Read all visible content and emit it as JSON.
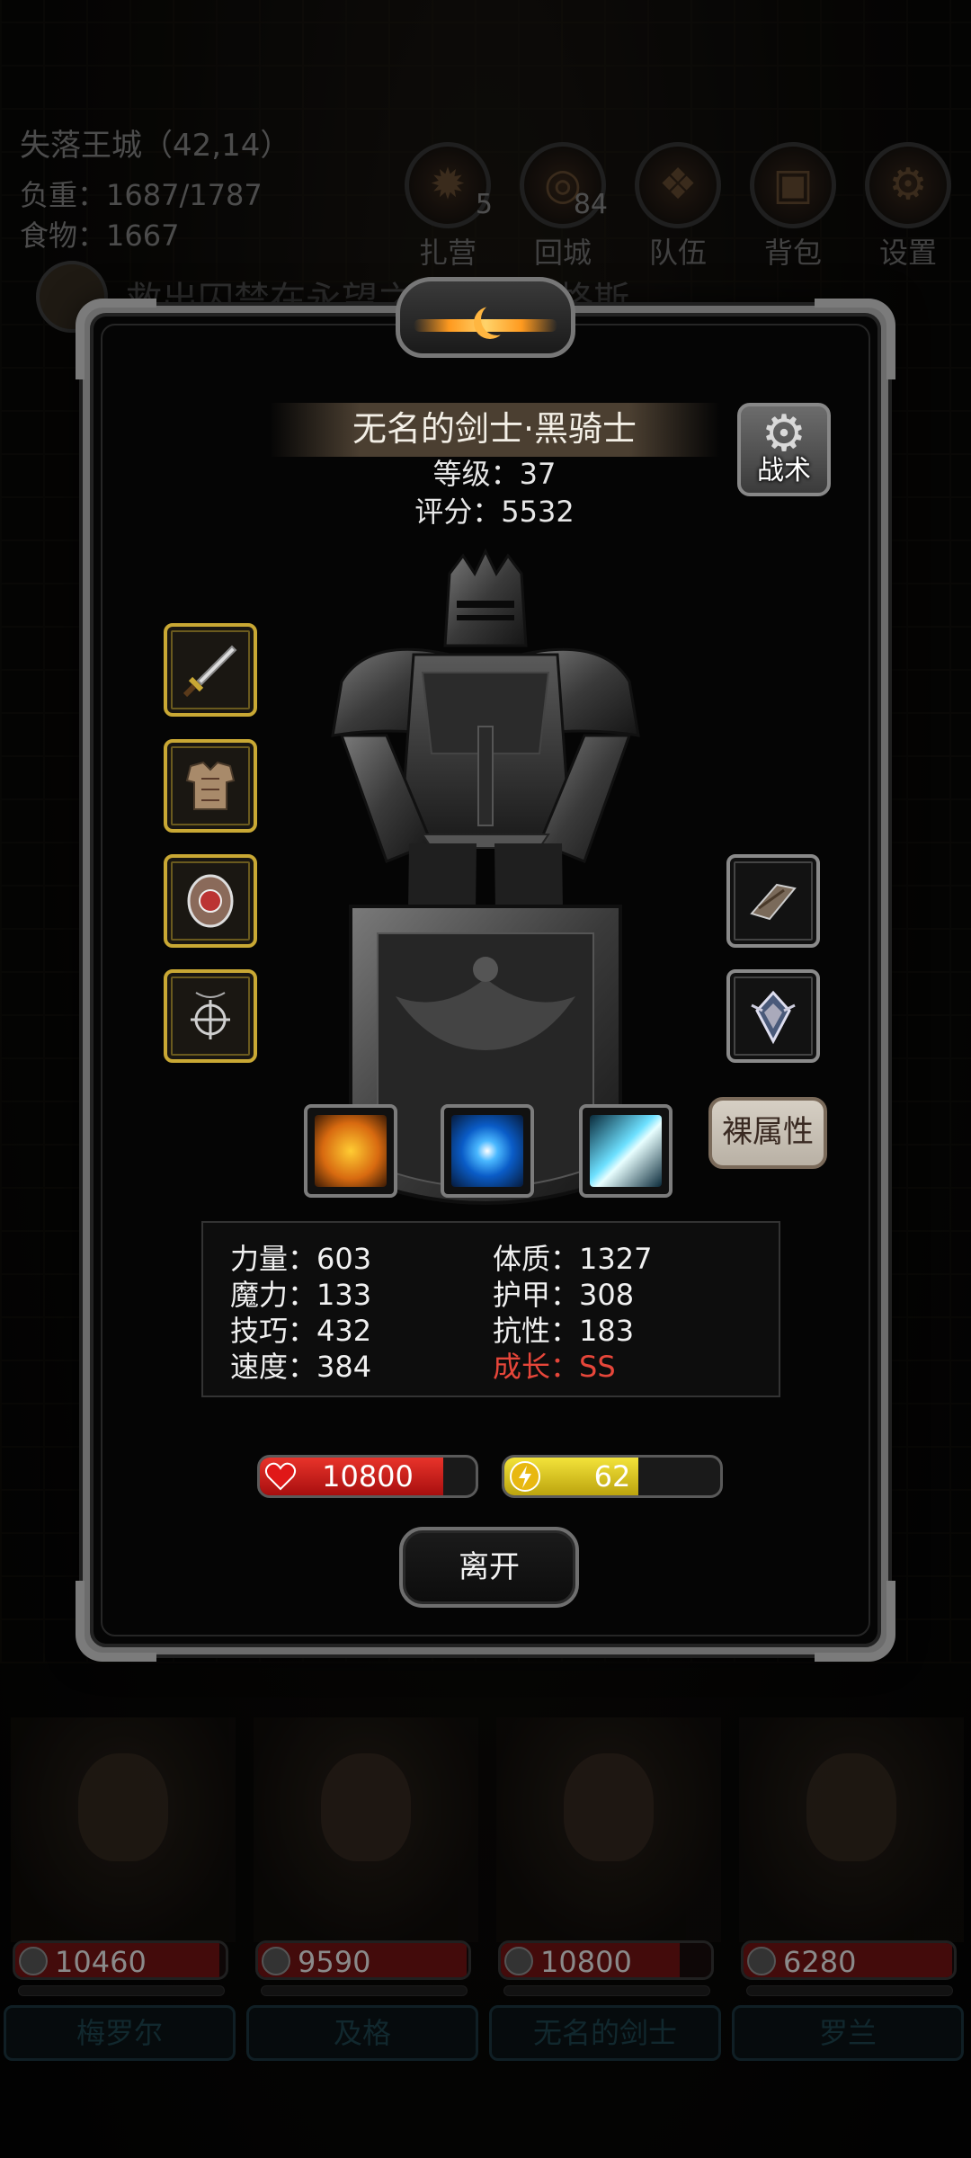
{
  "hud": {
    "location": "失落王城（42,14）",
    "load_label": "负重：",
    "load_value": "1687/1787",
    "food_label": "食物：",
    "food_value": "1667",
    "menu": [
      {
        "label": "扎营",
        "badge": "5",
        "icon": "campfire-icon"
      },
      {
        "label": "回城",
        "badge": "84",
        "icon": "portal-icon"
      },
      {
        "label": "队伍",
        "badge": "",
        "icon": "team-icon"
      },
      {
        "label": "背包",
        "badge": "",
        "icon": "backpack-icon"
      },
      {
        "label": "设置",
        "badge": "",
        "icon": "gear-icon"
      }
    ],
    "quest": "救出囚禁在永望之殿的克拉格斯"
  },
  "character": {
    "title": "无名的剑士·黑骑士",
    "level": "等级：37",
    "score": "评分：5532",
    "tactics_label": "战术",
    "bare_stats_label": "裸属性",
    "equipment_left": [
      "sword-icon",
      "armor-icon",
      "shield-ring-icon",
      "amulet-icon"
    ],
    "equipment_right": [
      "bracer-icon",
      "emblem-icon"
    ],
    "skills": [
      "dark-shield-skill-icon",
      "eye-skill-icon",
      "slash-skill-icon"
    ]
  },
  "stats": {
    "strength": "力量：603",
    "magic": "魔力：133",
    "skill": "技巧：432",
    "speed": "速度：384",
    "constitution": "体质：1327",
    "armor": "护甲：308",
    "resistance": "抗性：183",
    "growth": "成长：SS"
  },
  "bars": {
    "hp": "10800",
    "hp_fill": 0.85,
    "energy": "62",
    "energy_fill": 0.62
  },
  "leave_label": "离开",
  "party": [
    {
      "hp": "10460",
      "hp_fill": 0.97,
      "name": "梅罗尔"
    },
    {
      "hp": "9590",
      "hp_fill": 0.99,
      "name": "及格"
    },
    {
      "hp": "10800",
      "hp_fill": 0.85,
      "name": "无名的剑士"
    },
    {
      "hp": "6280",
      "hp_fill": 0.99,
      "name": "罗兰"
    }
  ],
  "colors": {
    "hp": "#d01c1c",
    "energy": "#e8d020",
    "growth": "#e6463a",
    "gold_frame": "#c9a834"
  }
}
